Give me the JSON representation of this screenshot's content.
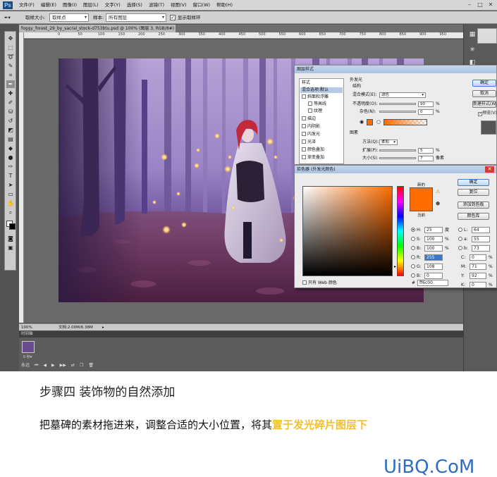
{
  "app": {
    "logo": "Ps",
    "menu": [
      "文件(F)",
      "编辑(E)",
      "图像(I)",
      "图层(L)",
      "文字(Y)",
      "选择(S)",
      "滤镜(T)",
      "视图(V)",
      "窗口(W)",
      "帮助(H)"
    ]
  },
  "options_bar": {
    "sample_size_label": "取样大小:",
    "sample_size_value": "取样点",
    "sample_label": "样本:",
    "sample_value": "所有图层",
    "ring_label": "显示取样环"
  },
  "document": {
    "tab_title": "foggy_forest_29_by_sacral_stock-d753btu.psd @ 100% (图层 3, RGB/8#) *"
  },
  "ruler_ticks": [
    "0",
    "50",
    "100",
    "150",
    "200",
    "250",
    "300",
    "350",
    "400",
    "450",
    "500",
    "550",
    "600",
    "650",
    "700",
    "750",
    "800",
    "850",
    "900",
    "950"
  ],
  "status_bar": {
    "zoom": "100%",
    "doc_info": "文档:2.00M/6.38M"
  },
  "timeline": {
    "label": "时间轴",
    "frame_time": "0 秒▾",
    "loop": "永远"
  },
  "layer_style": {
    "title": "图层样式",
    "list": [
      {
        "label": "样式",
        "checkbox": false
      },
      {
        "label": "混合选项:默认",
        "checkbox": false,
        "selected": true
      },
      {
        "label": "斜面和浮雕",
        "checkbox": true
      },
      {
        "label": "等高线",
        "checkbox": true
      },
      {
        "label": "纹理",
        "checkbox": true
      },
      {
        "label": "描边",
        "checkbox": true
      },
      {
        "label": "内阴影",
        "checkbox": true
      },
      {
        "label": "内发光",
        "checkbox": true
      },
      {
        "label": "光泽",
        "checkbox": true
      },
      {
        "label": "颜色叠加",
        "checkbox": true
      },
      {
        "label": "渐变叠加",
        "checkbox": true
      }
    ],
    "section_title": "外发光",
    "structure_label": "结构",
    "blend_mode_label": "混合模式(E):",
    "blend_mode_value": "滤色",
    "opacity_label": "不透明度(O):",
    "opacity_value": "90",
    "noise_label": "杂色(N):",
    "noise_value": "0",
    "percent": "%",
    "elements_label": "图素",
    "technique_label": "方法(Q):",
    "technique_value": "柔和",
    "spread_label": "扩展(P):",
    "spread_value": "5",
    "size_label": "大小(S):",
    "size_value": "7",
    "pixel_unit": "像素",
    "buttons": {
      "ok": "确定",
      "cancel": "取消",
      "new_style": "新建样式(W)...",
      "preview": "预览(V)"
    }
  },
  "color_picker": {
    "title": "拾色器 (外发光颜色)",
    "close": "✕",
    "new_label": "新的",
    "current_label": "当前",
    "buttons": {
      "ok": "确定",
      "reset": "复位",
      "add_swatches": "添加到色板",
      "libraries": "颜色库"
    },
    "web_only_label": "只有 Web 颜色",
    "new_color": "#ff6c00",
    "current_color": "#ff6c00",
    "hsb": [
      {
        "label": "H:",
        "value": "25",
        "unit": "度",
        "selected": true
      },
      {
        "label": "S:",
        "value": "100",
        "unit": "%",
        "selected": false
      },
      {
        "label": "B:",
        "value": "100",
        "unit": "%",
        "selected": false
      }
    ],
    "rgb": [
      {
        "label": "R:",
        "value": "255",
        "highlight": true
      },
      {
        "label": "G:",
        "value": "108"
      },
      {
        "label": "B:",
        "value": "0"
      }
    ],
    "lab": [
      {
        "label": "L:",
        "value": "64"
      },
      {
        "label": "a:",
        "value": "55"
      },
      {
        "label": "b:",
        "value": "73"
      }
    ],
    "cmyk": [
      {
        "label": "C:",
        "value": "0",
        "unit": "%"
      },
      {
        "label": "M:",
        "value": "71",
        "unit": "%"
      },
      {
        "label": "Y:",
        "value": "92",
        "unit": "%"
      },
      {
        "label": "K:",
        "value": "0",
        "unit": "%"
      }
    ],
    "hex_label": "#",
    "hex_value": "ff6c00"
  },
  "article": {
    "step_title": "步骤四  装饰物的自然添加",
    "body_prefix": "把墓碑的素材拖进来，调整合适的大小位置，将其",
    "body_highlight": "置于发光碎片图层下",
    "watermark": "UiBQ.CoM",
    "highlight_color": "#f2c02c",
    "watermark_color": "#2f6cc4"
  }
}
